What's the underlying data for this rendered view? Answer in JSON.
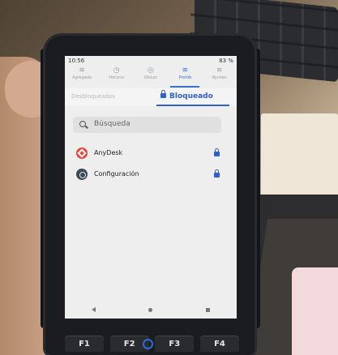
{
  "status": {
    "time": "10:56",
    "battery": "83 %"
  },
  "quick_settings": [
    {
      "label": "Agregado",
      "icon": "wifi-icon",
      "active": false
    },
    {
      "label": "Horario",
      "icon": "clock-icon",
      "active": false
    },
    {
      "label": "Ubicac",
      "icon": "location-icon",
      "active": false
    },
    {
      "label": "Prohib",
      "icon": "wifi-icon",
      "active": true
    },
    {
      "label": "Ajustes",
      "icon": "wifi-icon",
      "active": false
    }
  ],
  "tabs": {
    "left_label": "Desbloqueadas",
    "right_label": "Bloqueado"
  },
  "search": {
    "placeholder": "Búsqueda"
  },
  "apps": [
    {
      "name": "AnyDesk",
      "icon": "anydesk-icon",
      "locked": true
    },
    {
      "name": "Configuración",
      "icon": "settings-icon",
      "locked": true
    }
  ],
  "function_keys": [
    "F1",
    "F2",
    "F3",
    "F4"
  ],
  "colors": {
    "accent": "#2f62c9",
    "anydesk": "#ef443b"
  }
}
